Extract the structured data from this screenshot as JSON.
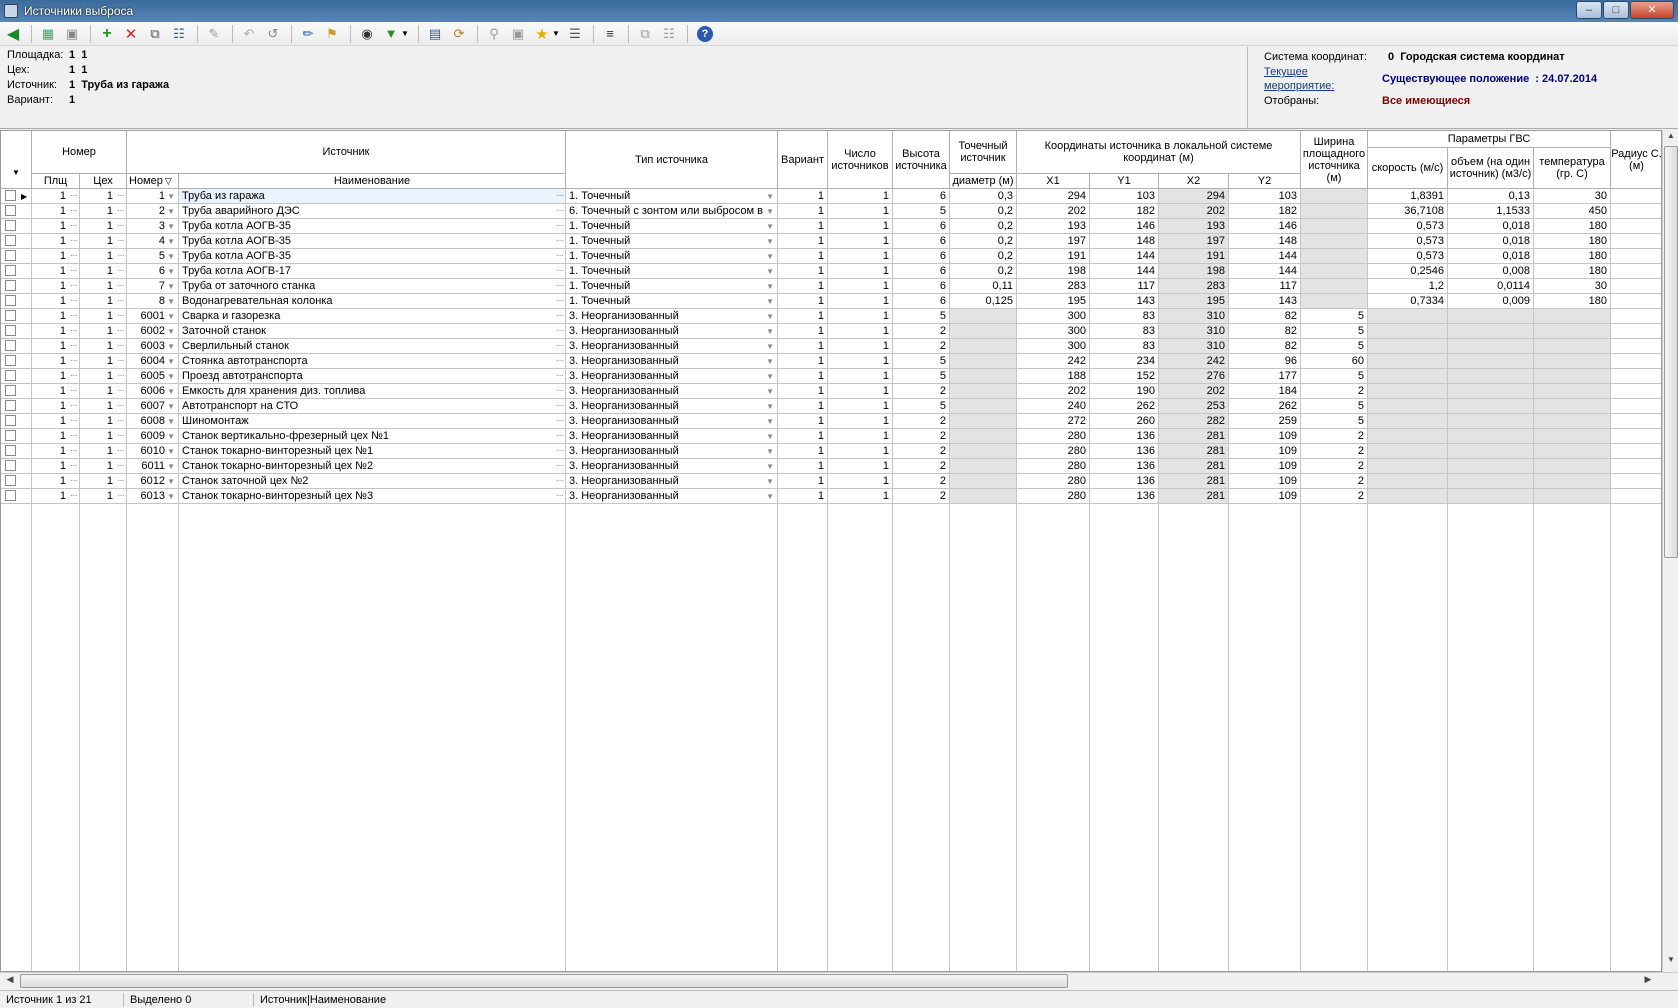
{
  "window": {
    "title": "Источники выброса"
  },
  "info": {
    "site_label": "Площадка:",
    "site_value": "1  1",
    "shop_label": "Цех:",
    "shop_value": "1  1",
    "source_label": "Источник:",
    "source_value": "1  Труба из гаража",
    "variant_label": "Вариант:",
    "variant_value": "1",
    "coord_label": "Система координат:",
    "coord_value": "0  Городская система координат",
    "event_label_1": "Текущее",
    "event_label_2": "мероприятие:",
    "event_value": "Существующее положение  : 24.07.2014",
    "filter_label": "Отобраны:",
    "filter_value": "Все имеющиеся"
  },
  "headers": {
    "nomer": "Номер",
    "plsh": "Плщ",
    "ceh": "Цех",
    "nomer_col": "Номер",
    "istochnik": "Источник",
    "naimenovanie": "Наименование",
    "tip": "Тип источника",
    "variant": "Вариант",
    "chislo": "Число источников",
    "vysota": "Высота источника",
    "tochechny": "Точечный источник",
    "diametr": "диаметр (м)",
    "coords": "Координаты источника в локальной системе координат (м)",
    "x1": "X1",
    "y1": "Y1",
    "x2": "X2",
    "y2": "Y2",
    "shirina": "Ширина площадного источника (м)",
    "gvs": "Параметры ГВС",
    "skorost": "скорость (м/с)",
    "obem": "объем (на один источник) (м3/с)",
    "temp": "температура (гр. С)",
    "radius": "Радиус С. (м)"
  },
  "rows": [
    {
      "plsh": "1",
      "ceh": "1",
      "nomer": "1",
      "name": "Труба из гаража",
      "tip": "1. Точечный",
      "variant": "1",
      "chislo": "1",
      "vysota": "6",
      "diam": "0,3",
      "x1": "294",
      "y1": "103",
      "x2": "294",
      "y2": "103",
      "shir": "",
      "skor": "1,8391",
      "obem": "0,13",
      "temp": "30"
    },
    {
      "plsh": "1",
      "ceh": "1",
      "nomer": "2",
      "name": "Труба аварийного ДЭС",
      "tip": "6. Точечный с зонтом или выбросом в",
      "variant": "1",
      "chislo": "1",
      "vysota": "5",
      "diam": "0,2",
      "x1": "202",
      "y1": "182",
      "x2": "202",
      "y2": "182",
      "shir": "",
      "skor": "36,7108",
      "obem": "1,1533",
      "temp": "450"
    },
    {
      "plsh": "1",
      "ceh": "1",
      "nomer": "3",
      "name": "Труба котла АОГВ-35",
      "tip": "1. Точечный",
      "variant": "1",
      "chislo": "1",
      "vysota": "6",
      "diam": "0,2",
      "x1": "193",
      "y1": "146",
      "x2": "193",
      "y2": "146",
      "shir": "",
      "skor": "0,573",
      "obem": "0,018",
      "temp": "180"
    },
    {
      "plsh": "1",
      "ceh": "1",
      "nomer": "4",
      "name": "Труба котла АОГВ-35",
      "tip": "1. Точечный",
      "variant": "1",
      "chislo": "1",
      "vysota": "6",
      "diam": "0,2",
      "x1": "197",
      "y1": "148",
      "x2": "197",
      "y2": "148",
      "shir": "",
      "skor": "0,573",
      "obem": "0,018",
      "temp": "180"
    },
    {
      "plsh": "1",
      "ceh": "1",
      "nomer": "5",
      "name": "Труба котла АОГВ-35",
      "tip": "1. Точечный",
      "variant": "1",
      "chislo": "1",
      "vysota": "6",
      "diam": "0,2",
      "x1": "191",
      "y1": "144",
      "x2": "191",
      "y2": "144",
      "shir": "",
      "skor": "0,573",
      "obem": "0,018",
      "temp": "180"
    },
    {
      "plsh": "1",
      "ceh": "1",
      "nomer": "6",
      "name": "Труба котла АОГВ-17",
      "tip": "1. Точечный",
      "variant": "1",
      "chislo": "1",
      "vysota": "6",
      "diam": "0,2",
      "x1": "198",
      "y1": "144",
      "x2": "198",
      "y2": "144",
      "shir": "",
      "skor": "0,2546",
      "obem": "0,008",
      "temp": "180"
    },
    {
      "plsh": "1",
      "ceh": "1",
      "nomer": "7",
      "name": "Труба от заточного станка",
      "tip": "1. Точечный",
      "variant": "1",
      "chislo": "1",
      "vysota": "6",
      "diam": "0,11",
      "x1": "283",
      "y1": "117",
      "x2": "283",
      "y2": "117",
      "shir": "",
      "skor": "1,2",
      "obem": "0,0114",
      "temp": "30"
    },
    {
      "plsh": "1",
      "ceh": "1",
      "nomer": "8",
      "name": "Водонагревательная колонка",
      "tip": "1. Точечный",
      "variant": "1",
      "chislo": "1",
      "vysota": "6",
      "diam": "0,125",
      "x1": "195",
      "y1": "143",
      "x2": "195",
      "y2": "143",
      "shir": "",
      "skor": "0,7334",
      "obem": "0,009",
      "temp": "180"
    },
    {
      "plsh": "1",
      "ceh": "1",
      "nomer": "6001",
      "name": "Сварка и газорезка",
      "tip": "3. Неорганизованный",
      "variant": "1",
      "chislo": "1",
      "vysota": "5",
      "diam": "",
      "x1": "300",
      "y1": "83",
      "x2": "310",
      "y2": "82",
      "shir": "5",
      "skor": "",
      "obem": "",
      "temp": ""
    },
    {
      "plsh": "1",
      "ceh": "1",
      "nomer": "6002",
      "name": "Заточной станок",
      "tip": "3. Неорганизованный",
      "variant": "1",
      "chislo": "1",
      "vysota": "2",
      "diam": "",
      "x1": "300",
      "y1": "83",
      "x2": "310",
      "y2": "82",
      "shir": "5",
      "skor": "",
      "obem": "",
      "temp": ""
    },
    {
      "plsh": "1",
      "ceh": "1",
      "nomer": "6003",
      "name": "Сверлильный станок",
      "tip": "3. Неорганизованный",
      "variant": "1",
      "chislo": "1",
      "vysota": "2",
      "diam": "",
      "x1": "300",
      "y1": "83",
      "x2": "310",
      "y2": "82",
      "shir": "5",
      "skor": "",
      "obem": "",
      "temp": ""
    },
    {
      "plsh": "1",
      "ceh": "1",
      "nomer": "6004",
      "name": "Стоянка автотранспорта",
      "tip": "3. Неорганизованный",
      "variant": "1",
      "chislo": "1",
      "vysota": "5",
      "diam": "",
      "x1": "242",
      "y1": "234",
      "x2": "242",
      "y2": "96",
      "shir": "60",
      "skor": "",
      "obem": "",
      "temp": ""
    },
    {
      "plsh": "1",
      "ceh": "1",
      "nomer": "6005",
      "name": "Проезд автотранспорта",
      "tip": "3. Неорганизованный",
      "variant": "1",
      "chislo": "1",
      "vysota": "5",
      "diam": "",
      "x1": "188",
      "y1": "152",
      "x2": "276",
      "y2": "177",
      "shir": "5",
      "skor": "",
      "obem": "",
      "temp": ""
    },
    {
      "plsh": "1",
      "ceh": "1",
      "nomer": "6006",
      "name": "Емкость для хранения диз. топлива",
      "tip": "3. Неорганизованный",
      "variant": "1",
      "chislo": "1",
      "vysota": "2",
      "diam": "",
      "x1": "202",
      "y1": "190",
      "x2": "202",
      "y2": "184",
      "shir": "2",
      "skor": "",
      "obem": "",
      "temp": ""
    },
    {
      "plsh": "1",
      "ceh": "1",
      "nomer": "6007",
      "name": "Автотранспорт на СТО",
      "tip": "3. Неорганизованный",
      "variant": "1",
      "chislo": "1",
      "vysota": "5",
      "diam": "",
      "x1": "240",
      "y1": "262",
      "x2": "253",
      "y2": "262",
      "shir": "5",
      "skor": "",
      "obem": "",
      "temp": ""
    },
    {
      "plsh": "1",
      "ceh": "1",
      "nomer": "6008",
      "name": "Шиномонтаж",
      "tip": "3. Неорганизованный",
      "variant": "1",
      "chislo": "1",
      "vysota": "2",
      "diam": "",
      "x1": "272",
      "y1": "260",
      "x2": "282",
      "y2": "259",
      "shir": "5",
      "skor": "",
      "obem": "",
      "temp": ""
    },
    {
      "plsh": "1",
      "ceh": "1",
      "nomer": "6009",
      "name": "Станок вертикально-фрезерный цех №1",
      "tip": "3. Неорганизованный",
      "variant": "1",
      "chislo": "1",
      "vysota": "2",
      "diam": "",
      "x1": "280",
      "y1": "136",
      "x2": "281",
      "y2": "109",
      "shir": "2",
      "skor": "",
      "obem": "",
      "temp": ""
    },
    {
      "plsh": "1",
      "ceh": "1",
      "nomer": "6010",
      "name": "Станок токарно-винторезный цех №1",
      "tip": "3. Неорганизованный",
      "variant": "1",
      "chislo": "1",
      "vysota": "2",
      "diam": "",
      "x1": "280",
      "y1": "136",
      "x2": "281",
      "y2": "109",
      "shir": "2",
      "skor": "",
      "obem": "",
      "temp": ""
    },
    {
      "plsh": "1",
      "ceh": "1",
      "nomer": "6011",
      "name": "Станок токарно-винторезный цех №2",
      "tip": "3. Неорганизованный",
      "variant": "1",
      "chislo": "1",
      "vysota": "2",
      "diam": "",
      "x1": "280",
      "y1": "136",
      "x2": "281",
      "y2": "109",
      "shir": "2",
      "skor": "",
      "obem": "",
      "temp": ""
    },
    {
      "plsh": "1",
      "ceh": "1",
      "nomer": "6012",
      "name": "Станок заточной цех №2",
      "tip": "3. Неорганизованный",
      "variant": "1",
      "chislo": "1",
      "vysota": "2",
      "diam": "",
      "x1": "280",
      "y1": "136",
      "x2": "281",
      "y2": "109",
      "shir": "2",
      "skor": "",
      "obem": "",
      "temp": ""
    },
    {
      "plsh": "1",
      "ceh": "1",
      "nomer": "6013",
      "name": "Станок токарно-винторезный цех №3",
      "tip": "3. Неорганизованный",
      "variant": "1",
      "chislo": "1",
      "vysota": "2",
      "diam": "",
      "x1": "280",
      "y1": "136",
      "x2": "281",
      "y2": "109",
      "shir": "2",
      "skor": "",
      "obem": "",
      "temp": ""
    }
  ],
  "status": {
    "position": "Источник 1 из 21",
    "selected": "Выделено 0",
    "sort": "Источник|Наименование"
  },
  "colors": {
    "title_bar": "#4a78a8",
    "event_value": "#000080",
    "filter_value": "#800000"
  },
  "icons": [
    "back-icon",
    "save-icon",
    "page-icon",
    "add-icon",
    "delete-icon",
    "copy-icon",
    "paste-icon",
    "wand-icon",
    "undo-icon",
    "redo-icon",
    "edit-icon",
    "folder-icon",
    "binoculars-icon",
    "filter-icon",
    "grid-icon",
    "refresh-icon",
    "key-icon",
    "doc-icon",
    "star-icon",
    "list-icon",
    "columns-icon",
    "copy2-icon",
    "paste2-icon",
    "help-icon"
  ]
}
